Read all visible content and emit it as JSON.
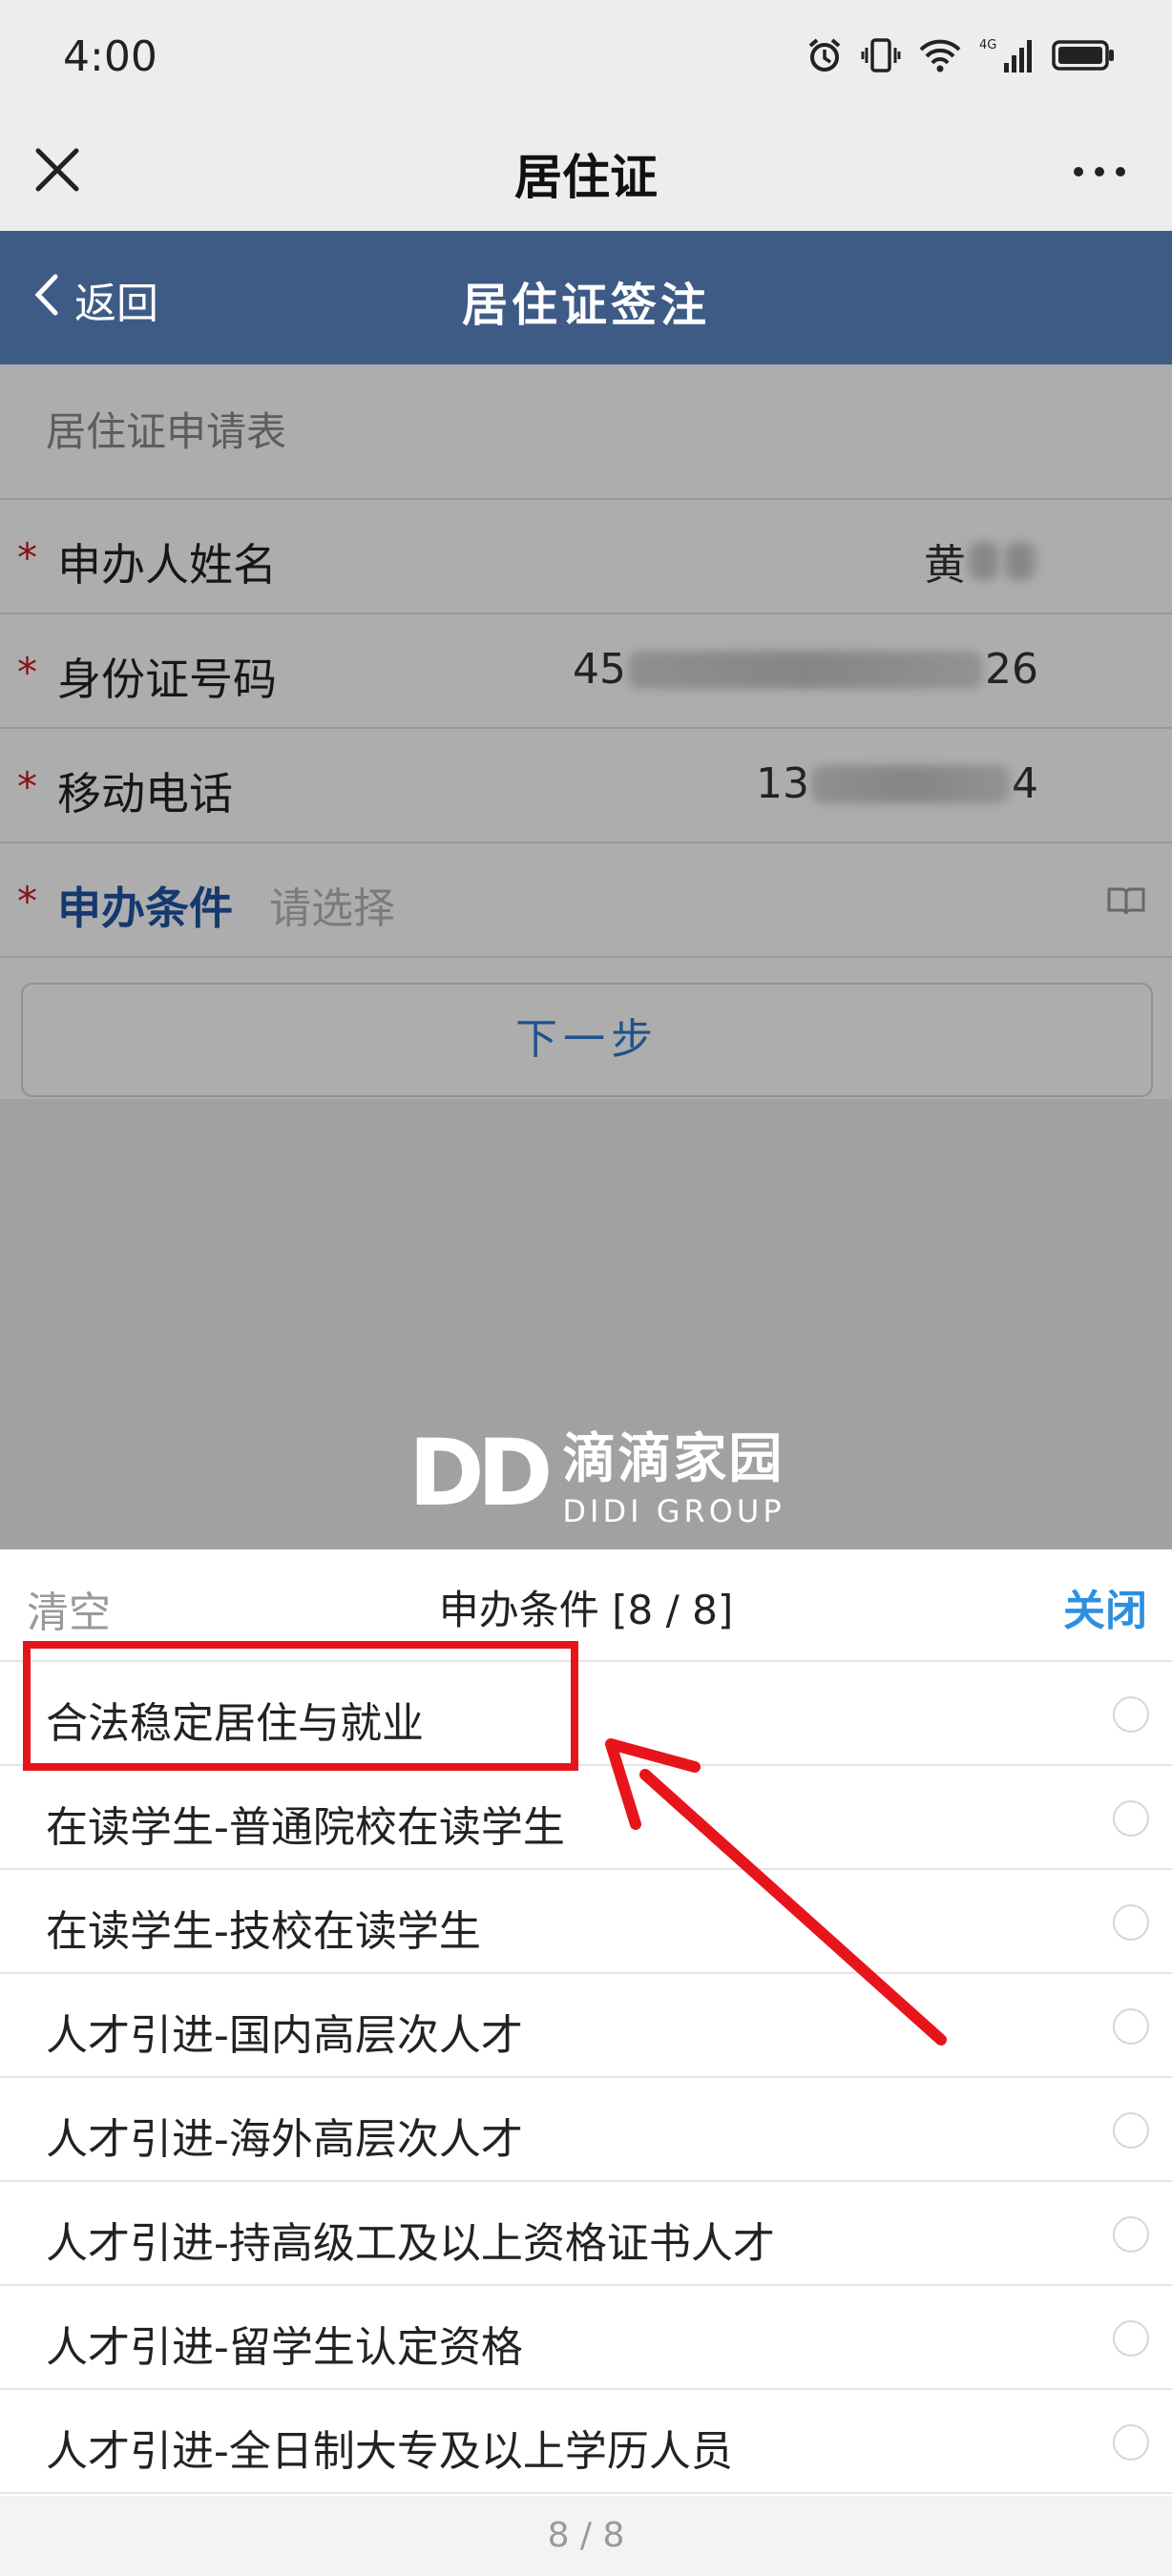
{
  "status_bar": {
    "time": "4:00",
    "icons": [
      "alarm-icon",
      "vibrate-icon",
      "wifi-icon",
      "signal-4g-icon",
      "battery-icon"
    ],
    "network_label": "4G"
  },
  "wechat_bar": {
    "title": "居住证",
    "close_icon": "close-icon",
    "more_icon": "more-icon"
  },
  "page_header": {
    "back_label": "返回",
    "title": "居住证签注"
  },
  "form": {
    "section_title": "居住证申请表",
    "fields": [
      {
        "label": "申办人姓名",
        "value_prefix": "黄",
        "value_suffix": "",
        "required": true
      },
      {
        "label": "身份证号码",
        "value_prefix": "45",
        "value_suffix": "26",
        "required": true
      },
      {
        "label": "移动电话",
        "value_prefix": "13",
        "value_suffix": "4",
        "required": true
      }
    ],
    "required_mark": "*",
    "condition": {
      "label": "申办条件",
      "placeholder": "请选择"
    },
    "next_button": "下一步"
  },
  "watermark": {
    "logo": "DD",
    "name": "滴滴家园",
    "subtitle": "DIDI GROUP"
  },
  "picker": {
    "clear_label": "清空",
    "title": "申办条件 [8 / 8]",
    "close_label": "关闭",
    "options": [
      "合法稳定居住与就业",
      "在读学生-普通院校在读学生",
      "在读学生-技校在读学生",
      "人才引进-国内高层次人才",
      "人才引进-海外高层次人才",
      "人才引进-持高级工及以上资格证书人才",
      "人才引进-留学生认定资格",
      "人才引进-全日制大专及以上学历人员"
    ],
    "footer": "8 / 8"
  },
  "colors": {
    "header_blue": "#3e5b86",
    "accent_blue": "#2d8fe0",
    "required_red": "#c91d1d",
    "annotation_red": "#e8141b"
  }
}
